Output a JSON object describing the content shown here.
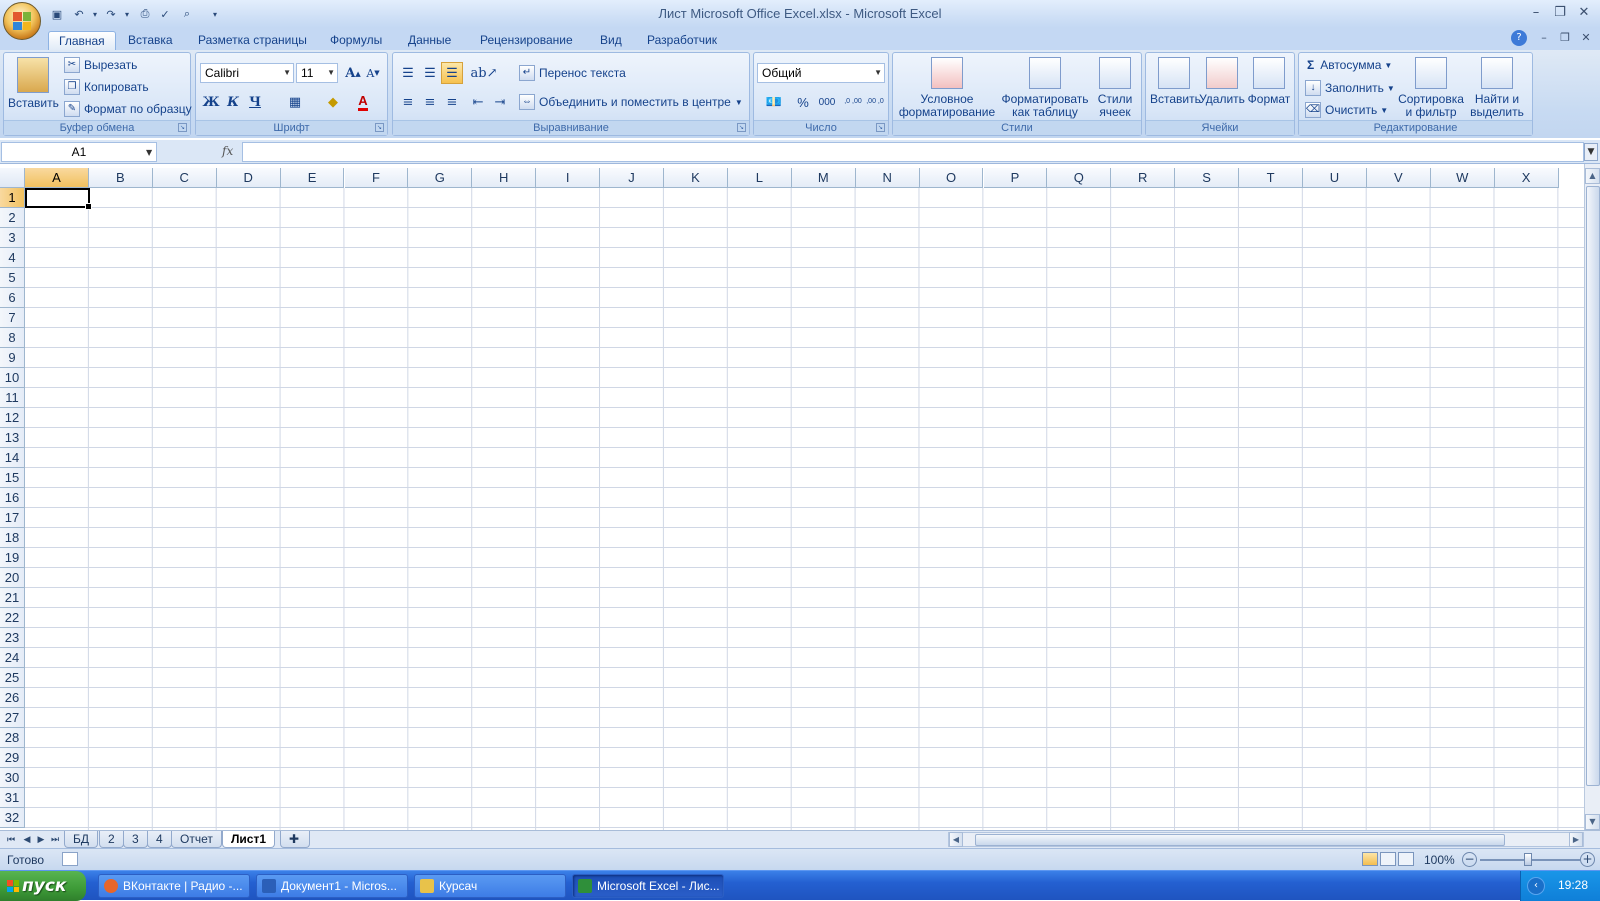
{
  "window": {
    "title": "Лист Microsoft Office Excel.xlsx - Microsoft Excel",
    "controls": [
      "–",
      "❐",
      "✕"
    ],
    "doc_controls": [
      "–",
      "❐",
      "✕"
    ]
  },
  "ribbon_tabs": [
    {
      "label": "Главная",
      "active": true
    },
    {
      "label": "Вставка",
      "active": false
    },
    {
      "label": "Разметка страницы",
      "active": false
    },
    {
      "label": "Формулы",
      "active": false
    },
    {
      "label": "Данные",
      "active": false
    },
    {
      "label": "Рецензирование",
      "active": false
    },
    {
      "label": "Вид",
      "active": false
    },
    {
      "label": "Разработчик",
      "active": false
    }
  ],
  "clipboard": {
    "group": "Буфер обмена",
    "paste": "Вставить",
    "cut": "Вырезать",
    "copy": "Копировать",
    "format_painter": "Формат по образцу"
  },
  "font": {
    "group": "Шрифт",
    "name": "Calibri",
    "size": "11",
    "grow": "A",
    "shrink": "A",
    "bold": "Ж",
    "italic": "К",
    "underline": "Ч",
    "color_letter": "A"
  },
  "alignment": {
    "group": "Выравнивание",
    "wrap": "Перенос текста",
    "merge": "Объединить и поместить в центре"
  },
  "number": {
    "group": "Число",
    "format": "Общий",
    "percent": "%",
    "thousands": "000",
    "inc_decimal": ",0 ,00",
    "dec_decimal": ",00 ,0"
  },
  "styles": {
    "group": "Стили",
    "conditional": [
      "Условное",
      "форматирование"
    ],
    "as_table": [
      "Форматировать",
      "как таблицу"
    ],
    "cell_styles": [
      "Стили",
      "ячеек"
    ]
  },
  "cells": {
    "group": "Ячейки",
    "insert": "Вставить",
    "delete": "Удалить",
    "format": "Формат"
  },
  "editing": {
    "group": "Редактирование",
    "autosum": "Автосумма",
    "fill": "Заполнить",
    "clear": "Очистить",
    "sort": [
      "Сортировка",
      "и фильтр"
    ],
    "find": [
      "Найти и",
      "выделить"
    ]
  },
  "formula_bar": {
    "name_box": "A1",
    "fx": "fx",
    "formula": ""
  },
  "sheet": {
    "columns": [
      "A",
      "B",
      "C",
      "D",
      "E",
      "F",
      "G",
      "H",
      "I",
      "J",
      "K",
      "L",
      "M",
      "N",
      "O",
      "P",
      "Q",
      "R",
      "S",
      "T",
      "U",
      "V",
      "W",
      "X"
    ],
    "rows": [
      "1",
      "2",
      "3",
      "4",
      "5",
      "6",
      "7",
      "8",
      "9",
      "10",
      "11",
      "12",
      "13",
      "14",
      "15",
      "16",
      "17",
      "18",
      "19",
      "20",
      "21",
      "22",
      "23",
      "24",
      "25",
      "26",
      "27",
      "28",
      "29",
      "30",
      "31",
      "32"
    ],
    "active_cell": "A1"
  },
  "sheet_tabs": [
    {
      "label": "БД",
      "active": false
    },
    {
      "label": "2",
      "active": false
    },
    {
      "label": "3",
      "active": false
    },
    {
      "label": "4",
      "active": false
    },
    {
      "label": "Отчет",
      "active": false
    },
    {
      "label": "Лист1",
      "active": true
    }
  ],
  "status": {
    "text": "Готово",
    "zoom": "100%"
  },
  "taskbar": {
    "start": "пуск",
    "tasks": [
      {
        "label": "ВКонтакте | Радио -...",
        "icon_color": "#e8662b",
        "active": false
      },
      {
        "label": "Документ1 - Micros...",
        "icon_color": "#2b5fb8",
        "active": false
      },
      {
        "label": "Курсач",
        "icon_color": "#e8c24a",
        "active": false
      },
      {
        "label": "Microsoft Excel - Лис...",
        "icon_color": "#2f8f3a",
        "active": true
      }
    ],
    "clock": "19:28"
  }
}
